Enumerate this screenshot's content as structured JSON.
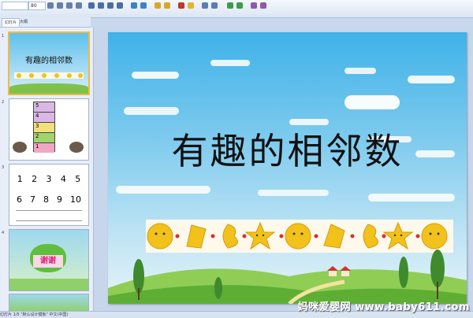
{
  "ribbon": {
    "font_value": "",
    "size_value": "80"
  },
  "panel": {
    "tabs": [
      "幻灯片",
      "大纲"
    ],
    "slide_numbers": [
      "1",
      "2",
      "3",
      "4"
    ],
    "thumb1_title": "有趣的相邻数",
    "thumb2_rows": [
      "5",
      "4",
      "3",
      "2",
      "1"
    ],
    "thumb3_row1": [
      "1",
      "2",
      "3",
      "4",
      "5"
    ],
    "thumb3_row2": [
      "6",
      "7",
      "8",
      "9",
      "10"
    ],
    "thumb4_text": "谢谢"
  },
  "slide": {
    "title": "有趣的相邻数"
  },
  "status": {
    "text": "幻灯片 1/5  \"默认设计模板\"  中文(中国)"
  },
  "watermark": {
    "text": "妈咪爱婴网 www.baby611.com"
  }
}
